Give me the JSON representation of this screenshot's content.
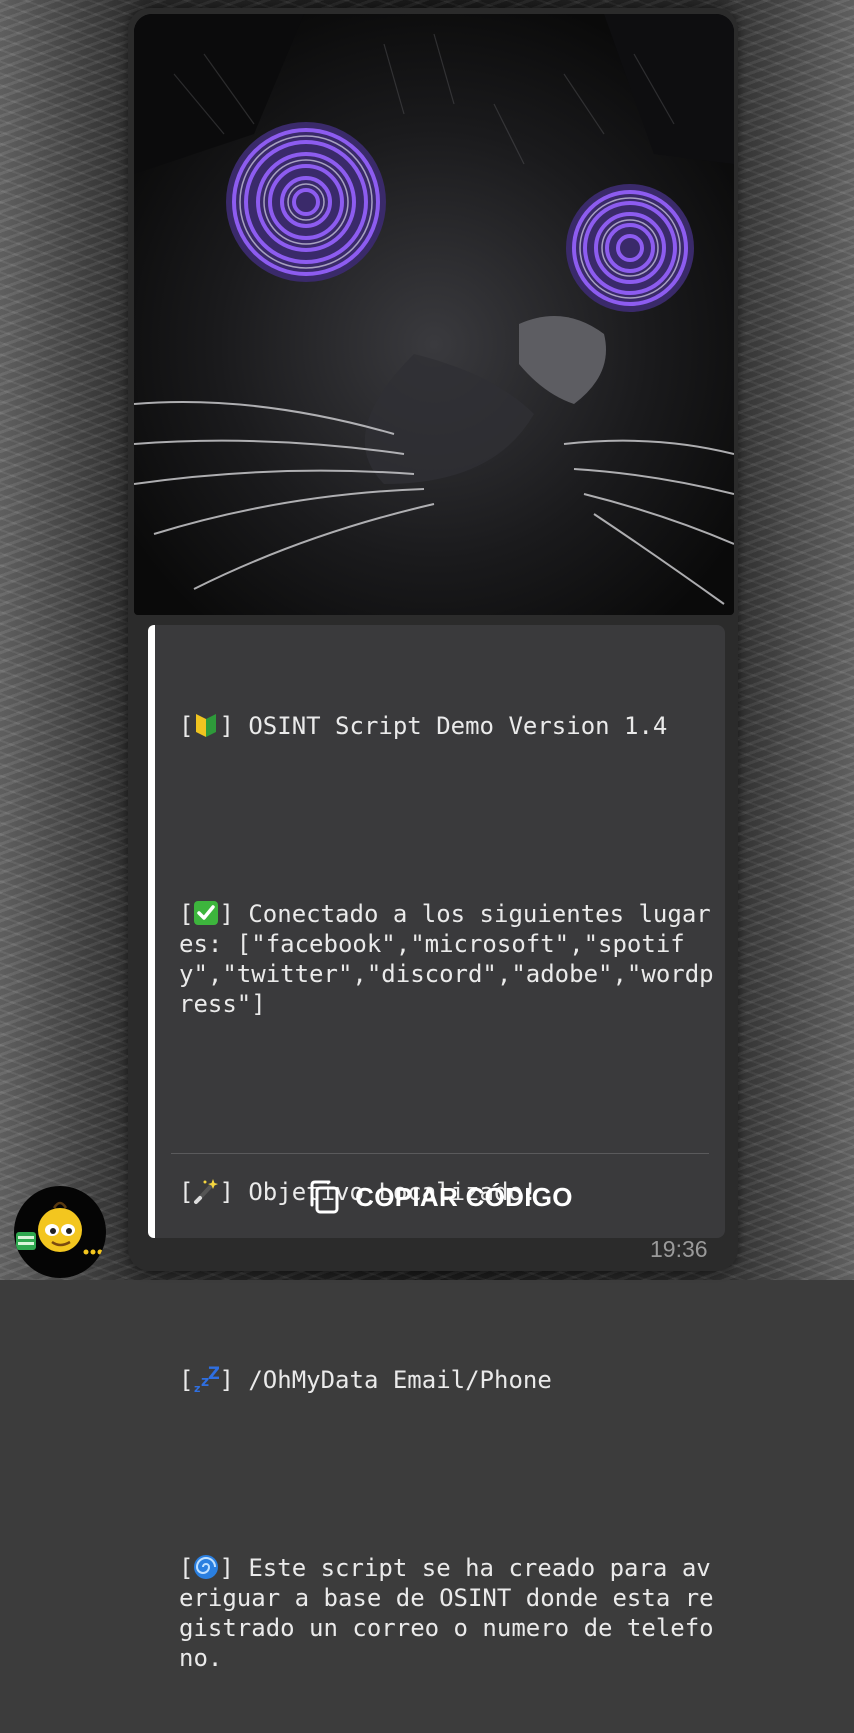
{
  "message": {
    "lines": [
      {
        "emoji": "beginner-badge-icon",
        "text": " OSINT Script Demo Version 1.4"
      },
      {
        "emoji": "check-mark-icon",
        "text": " Conectado a los siguientes lugares: [\"facebook\",\"microsoft\",\"spotify\",\"twitter\",\"discord\",\"adobe\",\"wordpress\"]"
      },
      {
        "emoji": "magic-wand-icon",
        "text": " Objetivo Localizado!"
      },
      {
        "emoji": "zzz-icon",
        "text": " /OhMyData Email/Phone"
      },
      {
        "emoji": "cyclone-icon",
        "text": " Este script se ha creado para averiguar a base de OSINT donde esta registrado un correo o numero de telefono."
      }
    ],
    "copy_button_label": "COPIAR CÓDIGO",
    "timestamp": "19:36"
  },
  "colors": {
    "bubble": "#2b2b2b",
    "code_card": "#3a3a3c",
    "accent_bar": "#ffffff",
    "eye_spiral": "#7b4bd8"
  }
}
